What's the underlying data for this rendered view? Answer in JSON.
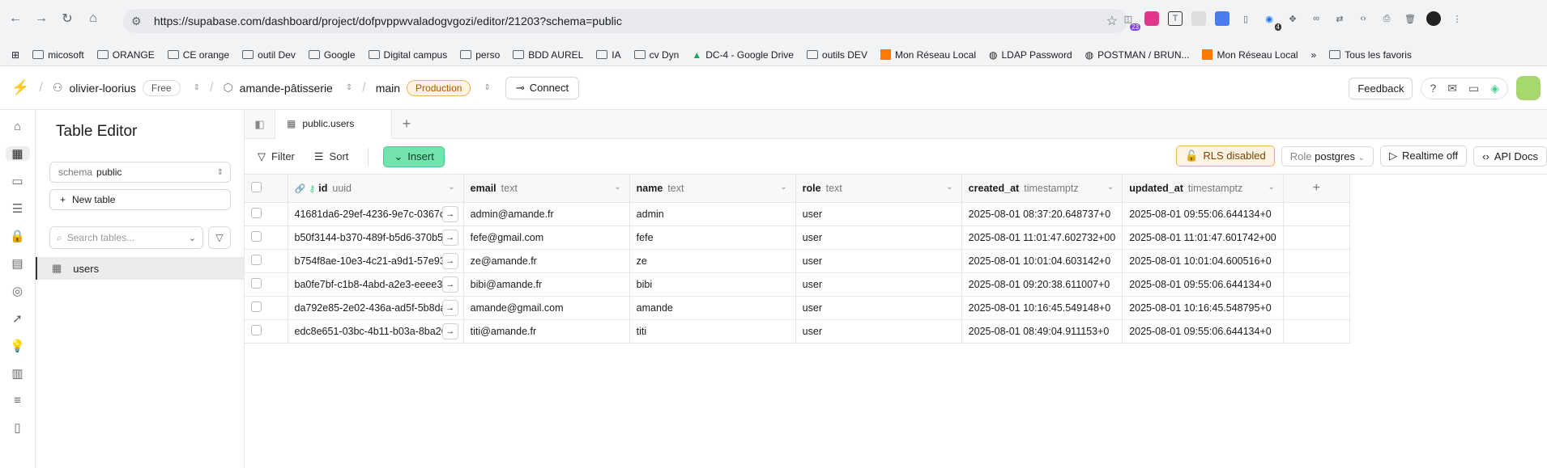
{
  "browser": {
    "url": "https://supabase.com/dashboard/project/dofpvppwvaladogvgozi/editor/21203?schema=public",
    "ext_badge_1": "23",
    "ext_badge_2": "4",
    "bookmarks": [
      "micosoft",
      "ORANGE",
      "CE orange",
      "outil Dev",
      "Google",
      "Digital campus",
      "perso",
      "BDD AUREL",
      "IA",
      "cv Dyn",
      "DC-4 - Google Drive",
      "outils DEV",
      "Mon Réseau Local",
      "LDAP Password",
      "POSTMAN / BRUN...",
      "Mon Réseau Local"
    ],
    "bookmarks_more": "»",
    "bookmarks_all": "Tous les favoris"
  },
  "header": {
    "org": "olivier-loorius",
    "plan": "Free",
    "project": "amande-pâtisserie",
    "branch": "main",
    "env": "Production",
    "connect": "Connect",
    "feedback": "Feedback"
  },
  "sidebar": {
    "title": "Table Editor",
    "schema_label": "schema",
    "schema_value": "public",
    "new_table": "New table",
    "search_placeholder": "Search tables...",
    "tables": [
      "users"
    ]
  },
  "tab": {
    "label": "public.users",
    "add": "+"
  },
  "toolbar": {
    "filter": "Filter",
    "sort": "Sort",
    "insert": "Insert",
    "rls": "RLS disabled",
    "role_label": "Role",
    "role_value": "postgres",
    "realtime": "Realtime off",
    "api_docs": "API Docs"
  },
  "columns": [
    {
      "name": "id",
      "type": "uuid"
    },
    {
      "name": "email",
      "type": "text"
    },
    {
      "name": "name",
      "type": "text"
    },
    {
      "name": "role",
      "type": "text"
    },
    {
      "name": "created_at",
      "type": "timestamptz"
    },
    {
      "name": "updated_at",
      "type": "timestamptz"
    }
  ],
  "rows": [
    [
      "41681da6-29ef-4236-9e7c-0367c...",
      "admin@amande.fr",
      "admin",
      "user",
      "2025-08-01 08:37:20.648737+0",
      "2025-08-01 09:55:06.644134+0"
    ],
    [
      "b50f3144-b370-489f-b5d6-370b5...",
      "fefe@gmail.com",
      "fefe",
      "user",
      "2025-08-01 11:01:47.602732+00",
      "2025-08-01 11:01:47.601742+00"
    ],
    [
      "b754f8ae-10e3-4c21-a9d1-57e93f...",
      "ze@amande.fr",
      "ze",
      "user",
      "2025-08-01 10:01:04.603142+0",
      "2025-08-01 10:01:04.600516+0"
    ],
    [
      "ba0fe7bf-c1b8-4abd-a2e3-eeee3...",
      "bibi@amande.fr",
      "bibi",
      "user",
      "2025-08-01 09:20:38.611007+0",
      "2025-08-01 09:55:06.644134+0"
    ],
    [
      "da792e85-2e02-436a-ad5f-5b8da...",
      "amande@gmail.com",
      "amande",
      "user",
      "2025-08-01 10:16:45.549148+0",
      "2025-08-01 10:16:45.548795+0"
    ],
    [
      "edc8e651-03bc-4b11-b03a-8ba26...",
      "titi@amande.fr",
      "titi",
      "user",
      "2025-08-01 08:49:04.911153+0",
      "2025-08-01 09:55:06.644134+0"
    ]
  ],
  "colors": {
    "accent": "#3ecf8e",
    "insert_bg": "#72e3ad",
    "warning_bg": "#fff4e3",
    "warning_border": "#f0b35b"
  }
}
